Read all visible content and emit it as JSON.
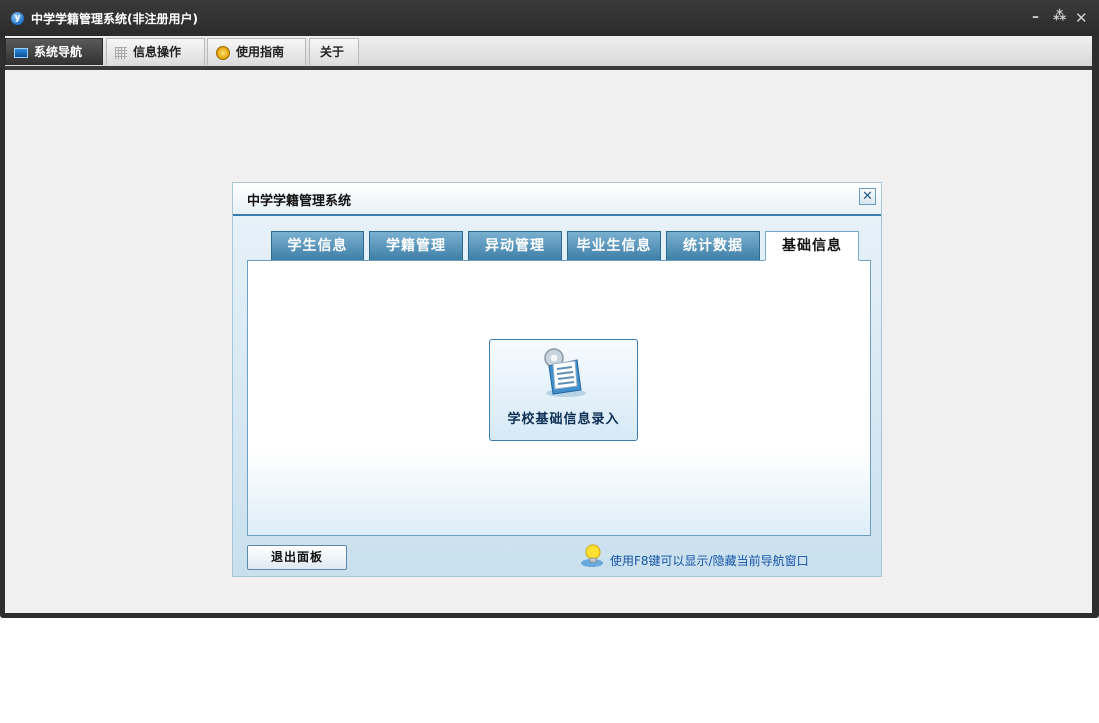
{
  "window": {
    "title": "中学学籍管理系统(非注册用户)"
  },
  "menu": {
    "tabs": [
      {
        "label": "系统导航",
        "icon": "monitor-icon",
        "active": true
      },
      {
        "label": "信息操作",
        "icon": "grid-icon",
        "active": false
      },
      {
        "label": "使用指南",
        "icon": "guide-icon",
        "active": false
      },
      {
        "label": "关于",
        "icon": "",
        "active": false
      }
    ]
  },
  "dialog": {
    "title": "中学学籍管理系统",
    "tabs": [
      {
        "label": "学生信息",
        "active": false
      },
      {
        "label": "学籍管理",
        "active": false
      },
      {
        "label": "异动管理",
        "active": false
      },
      {
        "label": "毕业生信息",
        "active": false
      },
      {
        "label": "统计数据",
        "active": false
      },
      {
        "label": "基础信息",
        "active": true
      }
    ],
    "tile": {
      "label": "学校基础信息录入",
      "icon": "document-settings-icon"
    },
    "exit_label": "退出面板",
    "hint": "使用F8键可以显示/隐藏当前导航窗口",
    "hint_icon": "lightbulb-icon"
  },
  "colors": {
    "accent": "#3a7dab",
    "tab_bg": "#4f8db6",
    "hint_text": "#1654a8"
  }
}
